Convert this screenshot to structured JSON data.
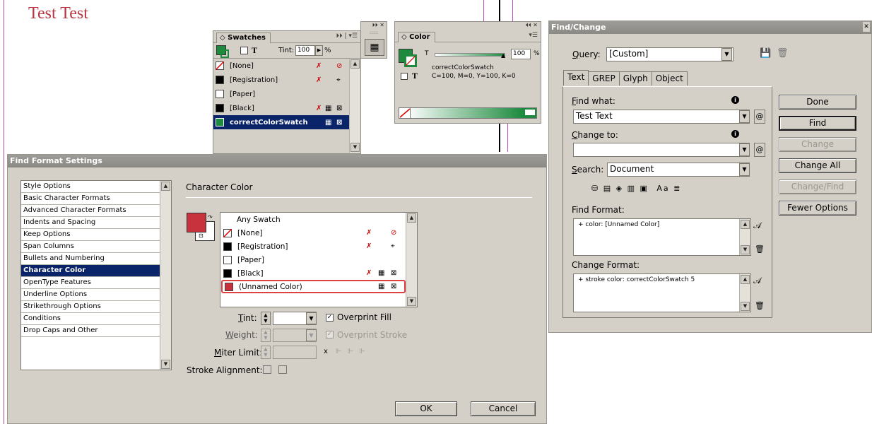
{
  "document": {
    "title": "Test Test"
  },
  "swatches_panel": {
    "tab": "Swatches",
    "tint_label": "Tint:",
    "tint_value": "100",
    "tint_unit": "%",
    "items": [
      {
        "name": "[None]",
        "color": "#ffffff"
      },
      {
        "name": "[Registration]",
        "color": "#000000"
      },
      {
        "name": "[Paper]",
        "color": "#ffffff"
      },
      {
        "name": "[Black]",
        "color": "#000000"
      },
      {
        "name": "correctColorSwatch",
        "color": "#1e8a3e"
      }
    ]
  },
  "color_panel": {
    "tab": "Color",
    "tint_label": "T",
    "tint_value": "100",
    "tint_unit": "%",
    "swatch_name": "correctColorSwatch",
    "formula": "C=100, M=0, Y=100, K=0",
    "accent": "#1e8a3e"
  },
  "find_change": {
    "title": "Find/Change",
    "query_label": "Query:",
    "query_value": "[Custom]",
    "tabs": [
      "Text",
      "GREP",
      "Glyph",
      "Object"
    ],
    "find_what_label": "Find what:",
    "find_what_value": "Test Text",
    "change_to_label": "Change to:",
    "change_to_value": "",
    "search_label": "Search:",
    "search_value": "Document",
    "find_format_label": "Find Format:",
    "find_format_value": "+ color: [Unnamed Color]",
    "change_format_label": "Change Format:",
    "change_format_value": "+ stroke color: correctColorSwatch 5",
    "buttons": {
      "done": "Done",
      "find": "Find",
      "change": "Change",
      "change_all": "Change All",
      "change_find": "Change/Find",
      "fewer_options": "Fewer Options"
    },
    "search_icons_text": "Aa"
  },
  "find_format": {
    "title": "Find Format Settings",
    "categories": [
      "Style Options",
      "Basic Character Formats",
      "Advanced Character Formats",
      "Indents and Spacing",
      "Keep Options",
      "Span Columns",
      "Bullets and Numbering",
      "Character Color",
      "OpenType Features",
      "Underline Options",
      "Strikethrough Options",
      "Conditions",
      "Drop Caps and Other"
    ],
    "selected_index": 7,
    "section_title": "Character Color",
    "accent": "#c8323c",
    "swatches": [
      {
        "name": "Any Swatch",
        "color": ""
      },
      {
        "name": "[None]",
        "color": "#ffffff"
      },
      {
        "name": "[Registration]",
        "color": "#000000"
      },
      {
        "name": "[Paper]",
        "color": "#ffffff"
      },
      {
        "name": "[Black]",
        "color": "#000000"
      },
      {
        "name": "(Unnamed Color)",
        "color": "#c8323c"
      }
    ],
    "tint_label": "Tint:",
    "overprint_fill": "Overprint Fill",
    "weight_label": "Weight:",
    "overprint_stroke": "Overprint Stroke",
    "miter_label": "Miter Limit:",
    "miter_x": "x",
    "stroke_alignment_label": "Stroke Alignment:",
    "ok": "OK",
    "cancel": "Cancel"
  }
}
